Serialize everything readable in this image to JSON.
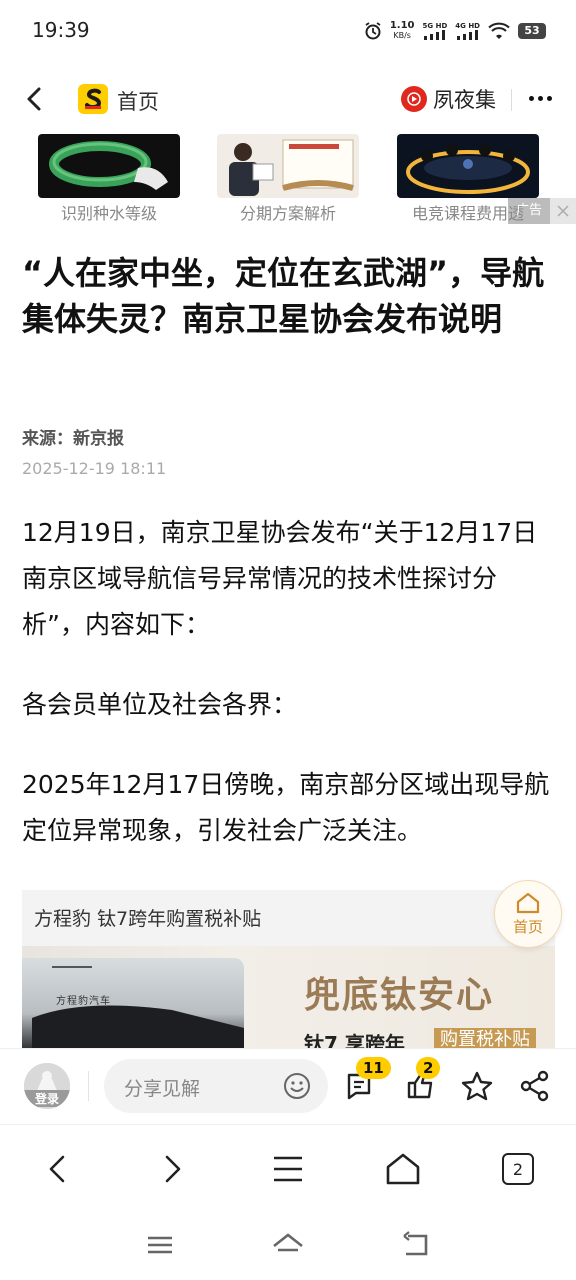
{
  "status": {
    "time": "19:39",
    "net_speed_value": "1.10",
    "net_speed_unit": "KB/s",
    "sig1": "5G HD",
    "sig2": "4G HD",
    "battery": "53"
  },
  "nav": {
    "home_label": "首页",
    "app_name": "夙夜集"
  },
  "ads": {
    "items": [
      {
        "caption": "识别种水等级"
      },
      {
        "caption": "分期方案解析"
      },
      {
        "caption": "电竞课程费用透"
      }
    ],
    "tag": "广告"
  },
  "article": {
    "title": "“人在家中坐，定位在玄武湖”，导航集体失灵？南京卫星协会发布说明",
    "source": "来源：新京报",
    "time": "2025-12-19 18:11",
    "paragraphs": [
      "12月19日，南京卫星协会发布“关于12月17日南京区域导航信号异常情况的技术性探讨分析”，内容如下：",
      "各会员单位及社会各界：",
      "2025年12月17日傍晚，南京部分区域出现导航定位异常现象，引发社会广泛关注。"
    ]
  },
  "big_ad": {
    "title": "方程豹 钛7跨年购置税补贴",
    "brand": "方程豹汽车",
    "slogan": "兜底钛安心",
    "sub": "钛7 享跨年",
    "sub_tag": "购置税补贴"
  },
  "float_home": {
    "label": "首页"
  },
  "comment_bar": {
    "avatar_label": "登录",
    "placeholder": "分享见解",
    "comment_count": "11",
    "like_count": "2"
  },
  "browser_bar": {
    "tab_count": "2"
  },
  "colors": {
    "accent": "#ffcc00",
    "brand_red": "#e0281f",
    "gold": "#d08a2a"
  }
}
